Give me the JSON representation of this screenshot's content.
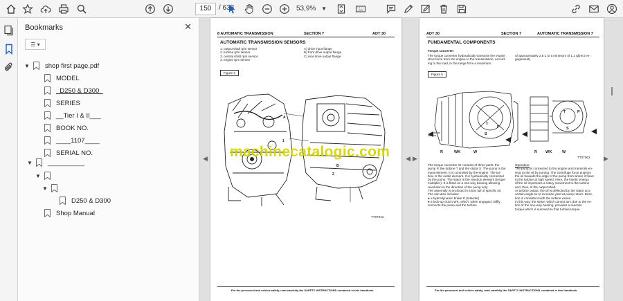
{
  "toolbar": {
    "page_current": "150",
    "page_total": "/ 638",
    "zoom": "53,9%"
  },
  "panel": {
    "title": "Bookmarks",
    "bookmarks": [
      {
        "label": "shop first page.pdf"
      },
      {
        "label": "MODEL"
      },
      {
        "label": "_D250 & D300_"
      },
      {
        "label": "SERIES"
      },
      {
        "label": "__Tier I & II___"
      },
      {
        "label": "BOOK NO."
      },
      {
        "label": "____1107____"
      },
      {
        "label": "SERIAL NO."
      },
      {
        "label": "__________"
      },
      {
        "label": ""
      },
      {
        "label": ""
      },
      {
        "label": "D250 & D300"
      },
      {
        "label": "Shop Manual"
      }
    ]
  },
  "left_page": {
    "header_left": "8   AUTOMATIC TRANSMISSION",
    "header_mid": "SECTION 7",
    "header_right": "ADT 30",
    "title": "AUTOMATIC TRANSMISSION SENSORS",
    "list_col1": [
      "1.      output shaft rpm sensor",
      "2.      turbine rpm sensor",
      "3.      central shaft rpm sensor",
      "4.      engine rpm sensor"
    ],
    "list_col2": [
      "A)      drive input flange",
      "B)      front drive output flange",
      "C)      rear drive output flange"
    ],
    "figure": "Figure 4",
    "fig_code": "TT07042",
    "callout_a": "A",
    "callout_b": "B",
    "callout_c": "C",
    "callout_1": "1",
    "callout_2": "2",
    "footer": "For the personnel and vehicle safety, read carefully the SAFETY INSTRUCTIONS contained in this handbook"
  },
  "right_page": {
    "header_left": "ADT 30",
    "header_mid": "SECTION 7",
    "header_right": "AUTOMATIC TRANSMISSION   7",
    "title": "FUNDAMENTAL COMPONENTS",
    "subtitle": "Torque converter",
    "intro_left": [
      "The torque converter hydraulically transmits the engine",
      "drive force from the engine to the transmission, accord-",
      "ing to the load, in the range from a maximum"
    ],
    "intro_right": [
      "of approximately 2.5:1 to a minimum of 1:1 (direct en-",
      "gagement)."
    ],
    "figure": "Figure 5",
    "fig_code": "TT07062",
    "labels": {
      "r": "R",
      "wk": "WK",
      "w": "W",
      "t": "T",
      "p": "P",
      "s": "S"
    },
    "body_left": [
      "The torque converter W consists of three parts: the",
      "pump P, the turbine T and the stator S. The pump is the",
      "input element. It is controlled by the engine.  The tur-",
      "bine is the outlet element. It is hydraulically connected",
      "by the pump. The stator is the reaction element (torque",
      "multiplier). It is fitted on a one-way bearing allowing",
      "revolution in the direction of the pump only.",
      "The assembly is enclosed in a box full of specific oil.",
      "The unit also includes:",
      "●  a hydrodynamic brake R (retarder)",
      "●  a lock-up clutch WK, which, when engaged, stiffly",
      "    connects the pump and the turbine."
    ],
    "operation_title": "Operation:",
    "body_right": [
      "The pump is connected to the engine and transmits en-",
      "ergy to the oil by turning. The centrifuge force projects",
      "the oil towards the edge of the pump from where it flows",
      "to the turbine at high speed. Here, the kinetic energy",
      "of the oil impresses a rotary movement to the turbine",
      "and, thus, to the output shaft.",
      "At turbine output, the oil is deflected by the stator at a",
      "certain angle so to increase yield at pump return. Direc-",
      "tion is consistent with the turbine vanes.",
      "In this way, the stator, which cannot turn due to the ex-",
      "tion of the one-way bearing, provides a reaction",
      "torque which is summed to that turbine torque."
    ],
    "footer": "For the personnel and vehicle safety, read carefully the SAFETY INSTRUCTIONS contained in this handbook"
  },
  "watermark": "machinecatalogic.com"
}
